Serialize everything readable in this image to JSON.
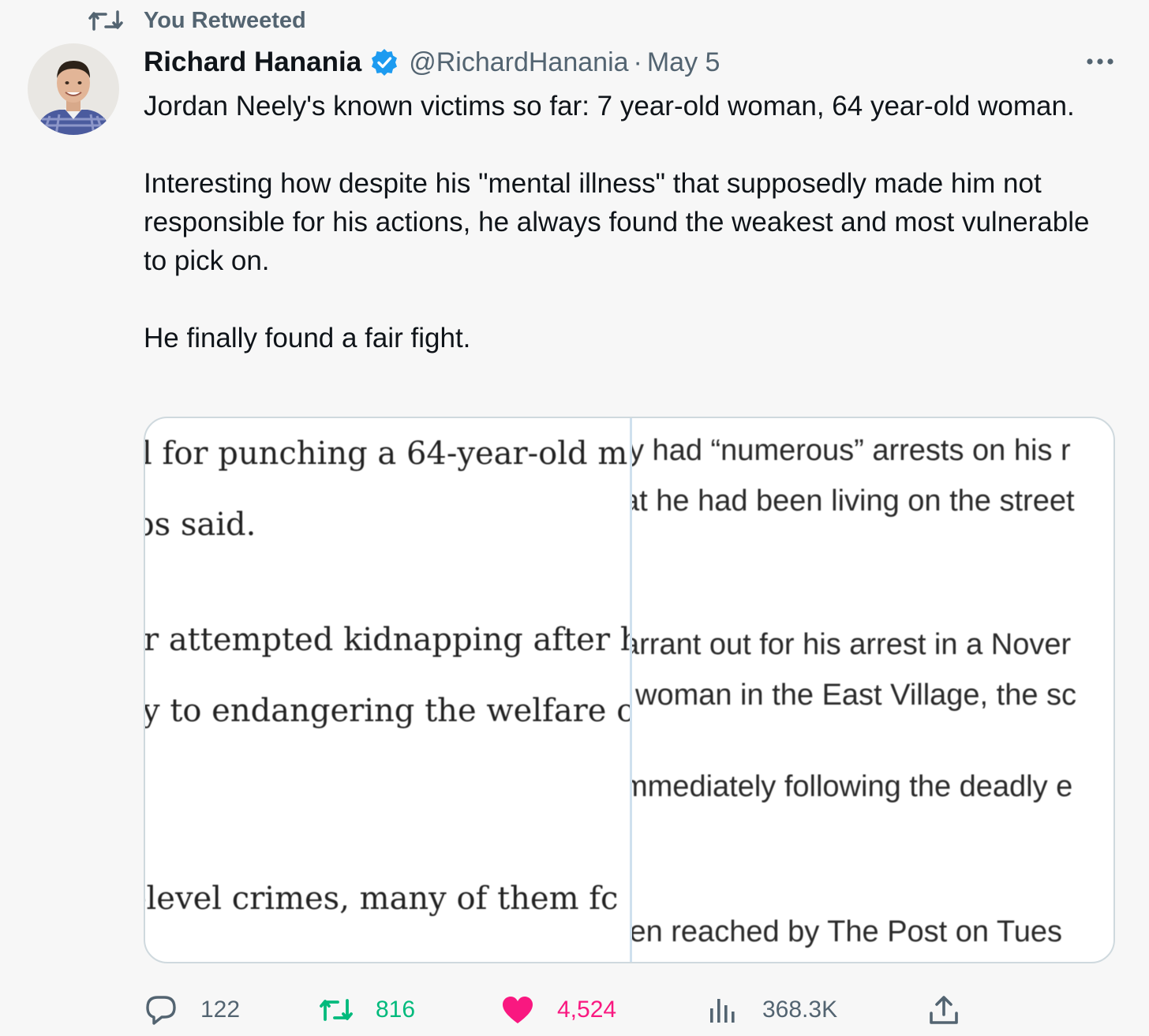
{
  "retweet_context": {
    "label": "You Retweeted"
  },
  "author": {
    "name": "Richard Hanania",
    "handle": "@RichardHanania",
    "separator": "·",
    "date": "May 5",
    "verified": true
  },
  "tweet": {
    "paragraphs": [
      "Jordan Neely's known victims so far: 7 year-old woman, 64 year-old woman.",
      "Interesting how despite his \"mental illness\" that supposedly made him not responsible for his actions, he always found the weakest and most vulnerable to pick on.",
      "He finally found a fair fight."
    ]
  },
  "media": {
    "left_crops": [
      "l for punching a 64-year-old m",
      "ps said.",
      "r attempted kidnapping after h",
      "y to endangering the welfare o",
      "-level crimes, many of them fc"
    ],
    "right_crops": [
      "y had “numerous” arrests on his r",
      "at he had been living on the street",
      "arrant out for his arrest in a Nover",
      "woman in the East Village, the sc",
      "mmediately following the deadly e",
      "ien reached by The Post on Tues"
    ]
  },
  "metrics": {
    "replies": "122",
    "retweets": "816",
    "likes": "4,524",
    "views": "368.3K"
  },
  "colors": {
    "retweet_active": "#00ba7c",
    "like_active": "#f91880",
    "verified_badge": "#1d9bf0",
    "muted": "#536471"
  },
  "icons": [
    "retweet-icon",
    "verified-badge-icon",
    "more-icon",
    "reply-icon",
    "retweet-icon",
    "heart-icon",
    "views-icon",
    "share-icon"
  ]
}
